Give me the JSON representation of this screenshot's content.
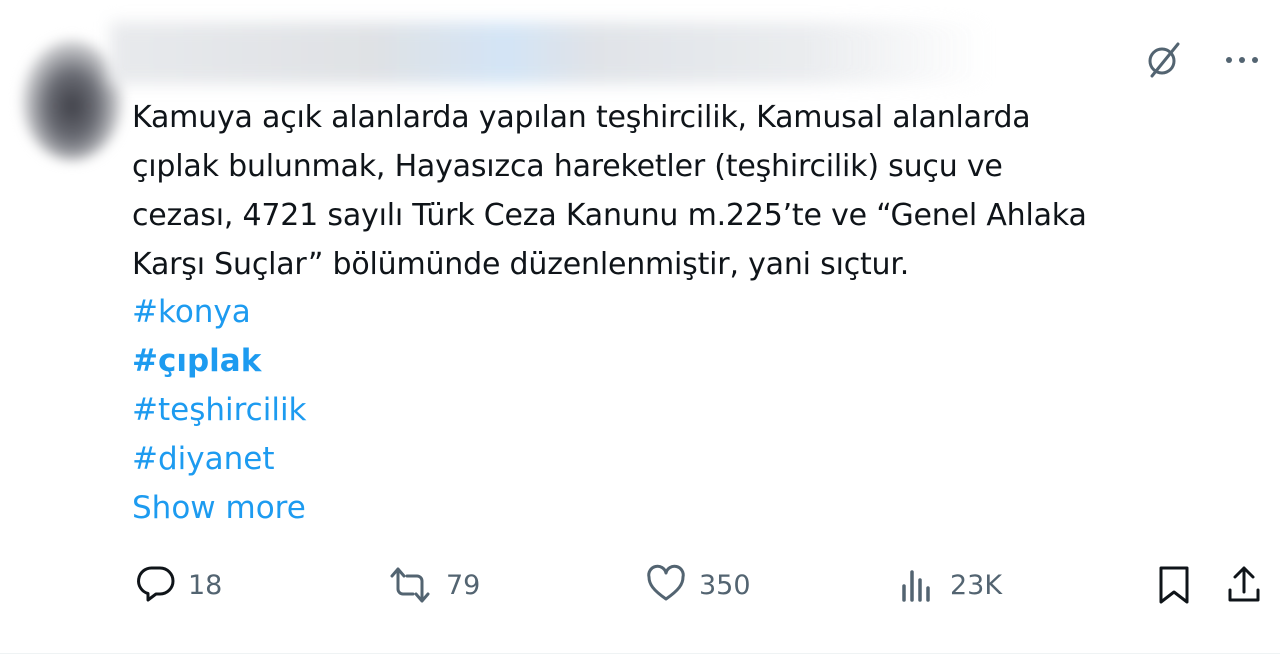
{
  "tweet": {
    "text_lines": [
      "Kamuya açık alanlarda yapılan teşhircilik, Kamusal alanlarda",
      "çıplak bulunmak, Hayasızca hareketler (teşhircilik) suçu ve",
      "cezası, 4721 sayılı Türk Ceza Kanunu m.225’te ve “Genel Ahlaka",
      "Karşı Suçlar” bölümünde düzenlenmiştir, yani sıçtur."
    ],
    "hashtags": [
      "#konya",
      "#çıplak",
      "#teşhircilik",
      "#diyanet"
    ],
    "show_more": "Show more"
  },
  "actions": {
    "replies": "18",
    "reposts": "79",
    "likes": "350",
    "views": "23K"
  },
  "icons": {
    "top": [
      "grok-icon",
      "more-icon"
    ],
    "bottom": [
      "reply-icon",
      "retweet-icon",
      "like-icon",
      "views-icon",
      "bookmark-icon",
      "share-icon"
    ]
  },
  "colors": {
    "link": "#1d9bf0",
    "text": "#0f1419",
    "muted": "#536471"
  }
}
